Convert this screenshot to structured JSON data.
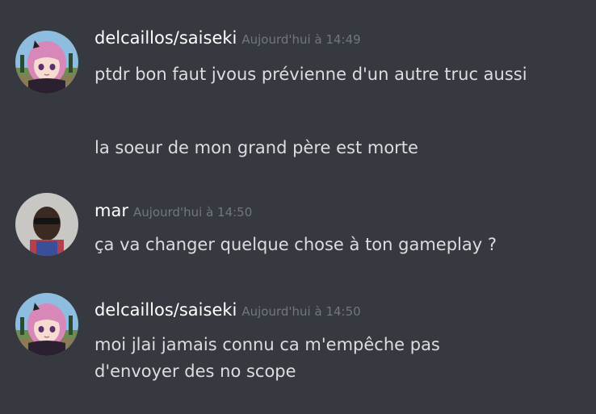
{
  "messages": [
    {
      "author": "delcaillos/saiseki",
      "timestamp": "Aujourd'hui à 14:49",
      "avatar_icon": "anime-avatar",
      "lines": [
        "ptdr bon faut jvous prévienne d'un autre truc aussi",
        "la soeur de mon grand père est morte"
      ]
    },
    {
      "author": "mar",
      "timestamp": "Aujourd'hui à 14:50",
      "avatar_icon": "photo-avatar",
      "lines": [
        "ça va changer quelque chose à ton gameplay ?"
      ]
    },
    {
      "author": "delcaillos/saiseki",
      "timestamp": "Aujourd'hui à 14:50",
      "avatar_icon": "anime-avatar",
      "lines": [
        "moi jlai jamais connu ca m'empêche pas d'envoyer des no scope"
      ]
    }
  ],
  "colors": {
    "background": "#36393f",
    "username": "#ffffff",
    "timestamp": "#72767d",
    "message_text": "#dcddde"
  }
}
